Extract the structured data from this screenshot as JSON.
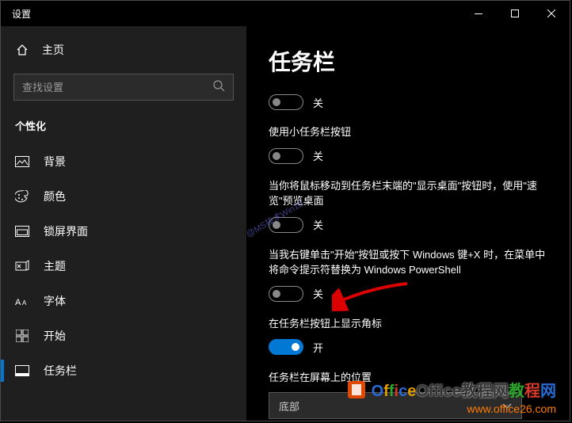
{
  "window": {
    "title": "设置"
  },
  "sidebar": {
    "home": "主页",
    "search_placeholder": "查找设置",
    "category": "个性化",
    "items": [
      {
        "label": "背景"
      },
      {
        "label": "颜色"
      },
      {
        "label": "锁屏界面"
      },
      {
        "label": "主题"
      },
      {
        "label": "字体"
      },
      {
        "label": "开始"
      },
      {
        "label": "任务栏"
      }
    ]
  },
  "content": {
    "heading": "任务栏",
    "settings": [
      {
        "state": "off",
        "state_label": "关"
      },
      {
        "desc": "使用小任务栏按钮",
        "state": "off",
        "state_label": "关"
      },
      {
        "desc": "当你将鼠标移动到任务栏末端的\"显示桌面\"按钮时，使用\"速览\"预览桌面",
        "state": "off",
        "state_label": "关"
      },
      {
        "desc": "当我右键单击\"开始\"按钮或按下 Windows 键+X 时，在菜单中将命令提示符替换为 Windows PowerShell",
        "state": "off",
        "state_label": "关"
      },
      {
        "desc": "在任务栏按钮上显示角标",
        "state": "on",
        "state_label": "开"
      }
    ],
    "position_label": "任务栏在屏幕上的位置",
    "position_value": "底部"
  },
  "watermark": {
    "brand": "Office教程网",
    "url": "www.office26.com",
    "faint": "@MS技术Win10"
  }
}
